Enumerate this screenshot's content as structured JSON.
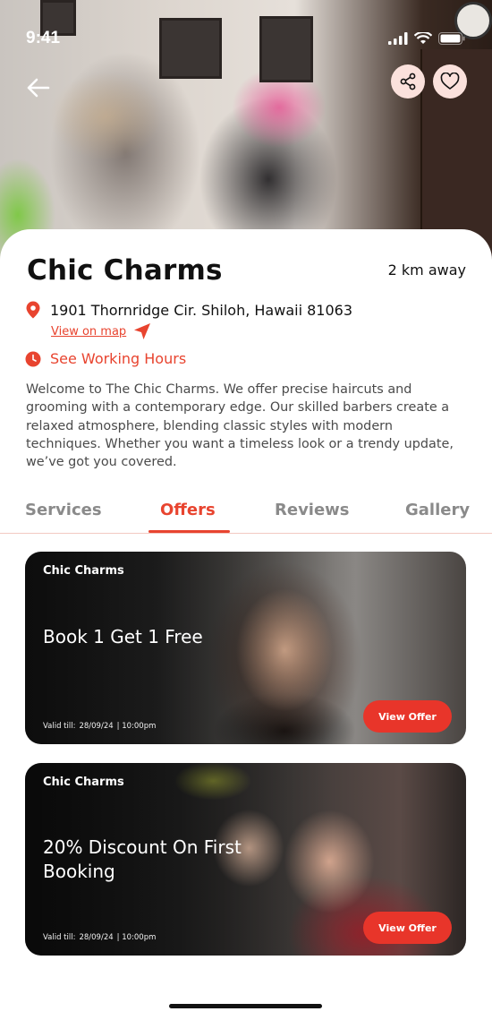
{
  "status_bar": {
    "time": "9:41"
  },
  "hero": {
    "photo": "salon-stylist-curling-client-photo"
  },
  "business": {
    "name": "Chic Charms",
    "distance": "2 km away",
    "address": "1901 Thornridge Cir. Shiloh, Hawaii 81063",
    "view_on_map": "View on map",
    "working_hours": "See Working Hours",
    "description": "Welcome to The Chic Charms. We offer precise haircuts and grooming with a contemporary edge. Our skilled barbers create a relaxed atmosphere, blending classic styles with modern techniques. Whether you want a timeless look or a trendy update, we’ve got you covered."
  },
  "tabs": [
    {
      "label": "Services",
      "active": false
    },
    {
      "label": "Offers",
      "active": true
    },
    {
      "label": "Reviews",
      "active": false
    },
    {
      "label": "Gallery",
      "active": false
    }
  ],
  "offers": [
    {
      "brand": "Chic Charms",
      "title": "Book 1 Get 1 Free",
      "valid_label": "Valid till:",
      "valid_date": "28/09/24",
      "valid_time": "| 10:00pm",
      "button": "View Offer"
    },
    {
      "brand": "Chic Charms",
      "title": "20% Discount On First Booking",
      "valid_label": "Valid till:",
      "valid_date": "28/09/24",
      "valid_time": "| 10:00pm",
      "button": "View Offer"
    }
  ],
  "colors": {
    "accent": "#e8442f",
    "button": "#e8352a",
    "icon_bg": "#fbe1dc",
    "text": "#111111",
    "muted": "#8a8a8a"
  }
}
